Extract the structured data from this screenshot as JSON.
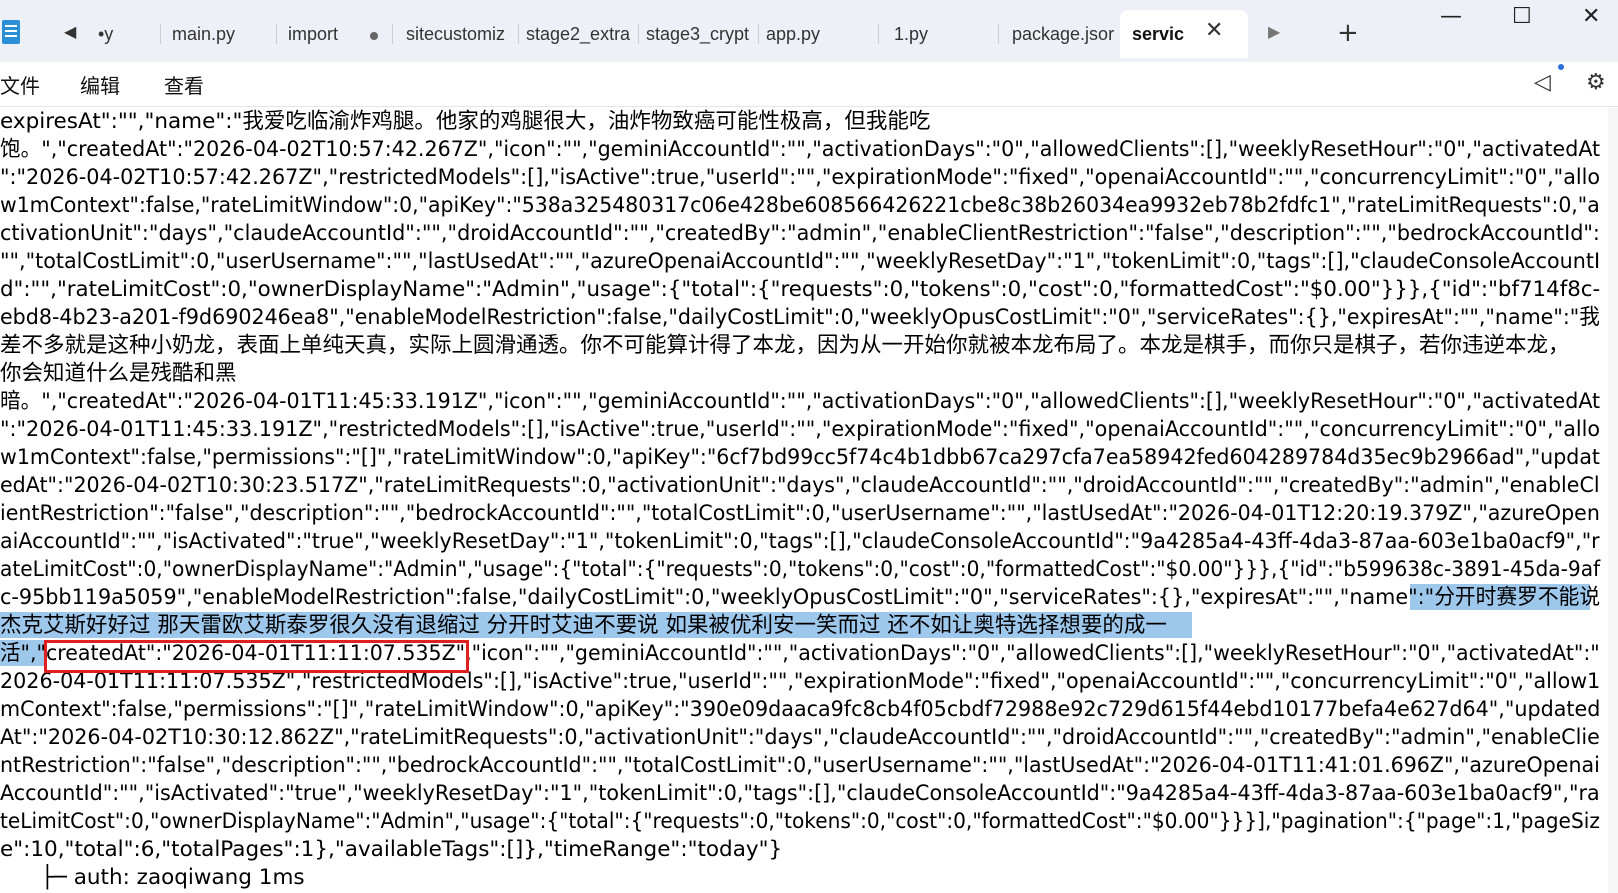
{
  "tabs": [
    {
      "label": "•y",
      "active": false
    },
    {
      "label": "main.py",
      "active": false
    },
    {
      "label": "import",
      "active": false,
      "unsaved": true
    },
    {
      "label": "sitecustomiz",
      "active": false
    },
    {
      "label": "stage2_extra",
      "active": false
    },
    {
      "label": "stage3_crypt",
      "active": false
    },
    {
      "label": "app.py",
      "active": false
    },
    {
      "label": "1.py",
      "active": false
    },
    {
      "label": "package.jsor",
      "active": false
    },
    {
      "label": "servic",
      "active": true
    }
  ],
  "menu": {
    "file": "文件",
    "edit": "编辑",
    "view": "查看"
  },
  "icons": {
    "app": "notepad-icon",
    "back": "◀",
    "forward": "▶",
    "close_tab": "✕",
    "new_tab": "+",
    "minimize": "—",
    "maximize": "☐",
    "close_window": "✕",
    "announce": "◁",
    "settings": "⚙"
  },
  "colors": {
    "tabbar_bg": "#eef0f8",
    "selection": "#9ec7ec",
    "highlight_box": "#e02020"
  },
  "lines": [
    "expiresAt\":\"\",\"name\":\"我爱吃临渝炸鸡腿。他家的鸡腿很大，油炸物致癌可能性极高，但我能吃",
    "饱。\",\"createdAt\":\"2026-04-02T10:57:42.267Z\",\"icon\":\"\",\"geminiAccountId\":\"\",\"activationDays\":\"0\",\"allowedClients\":[],\"weeklyResetHour\":\"0\",\"activatedAt",
    "\":\"2026-04-02T10:57:42.267Z\",\"restrictedModels\":[],\"isActive\":true,\"userId\":\"\",\"expirationMode\":\"fixed\",\"openaiAccountId\":\"\",\"concurrencyLimit\":\"0\",\"allo",
    "w1mContext\":false,\"rateLimitWindow\":0,\"apiKey\":\"538a325480317c06e428be608566426221cbe8c38b26034ea9932eb78b2fdfc1\",\"rateLimitRequests\":0,\"a",
    "ctivationUnit\":\"days\",\"claudeAccountId\":\"\",\"droidAccountId\":\"\",\"createdBy\":\"admin\",\"enableClientRestriction\":\"false\",\"description\":\"\",\"bedrockAccountId\":",
    "\"\",\"totalCostLimit\":0,\"userUsername\":\"\",\"lastUsedAt\":\"\",\"azureOpenaiAccountId\":\"\",\"weeklyResetDay\":\"1\",\"tokenLimit\":0,\"tags\":[],\"claudeConsoleAccountI",
    "d\":\"\",\"rateLimitCost\":0,\"ownerDisplayName\":\"Admin\",\"usage\":{\"total\":{\"requests\":0,\"tokens\":0,\"cost\":0,\"formattedCost\":\"$0.00\"}}},{\"id\":\"bf714f8c-",
    "ebd8-4b23-a201-f9d690246ea8\",\"enableModelRestriction\":false,\"dailyCostLimit\":0,\"weeklyOpusCostLimit\":\"0\",\"serviceRates\":{},\"expiresAt\":\"\",\"name\":\"我",
    "差不多就是这种小奶龙，表面上单纯天真，实际上圆滑通透。你不可能算计得了本龙，因为从一开始你就被本龙布局了。本龙是棋手，而你只是棋子，若你违逆本龙，",
    "你会知道什么是残酷和黑",
    "暗。\",\"createdAt\":\"2026-04-01T11:45:33.191Z\",\"icon\":\"\",\"geminiAccountId\":\"\",\"activationDays\":\"0\",\"allowedClients\":[],\"weeklyResetHour\":\"0\",\"activatedAt",
    "\":\"2026-04-01T11:45:33.191Z\",\"restrictedModels\":[],\"isActive\":true,\"userId\":\"\",\"expirationMode\":\"fixed\",\"openaiAccountId\":\"\",\"concurrencyLimit\":\"0\",\"allo",
    "w1mContext\":false,\"permissions\":\"[]\",\"rateLimitWindow\":0,\"apiKey\":\"6cf7bd99cc5f74c4b1dbb67ca297cfa7ea58942fed604289784d35ec9b2966ad\",\"updat",
    "edAt\":\"2026-04-02T10:30:23.517Z\",\"rateLimitRequests\":0,\"activationUnit\":\"days\",\"claudeAccountId\":\"\",\"droidAccountId\":\"\",\"createdBy\":\"admin\",\"enableCl",
    "ientRestriction\":\"false\",\"description\":\"\",\"bedrockAccountId\":\"\",\"totalCostLimit\":0,\"userUsername\":\"\",\"lastUsedAt\":\"2026-04-01T12:20:19.379Z\",\"azureOpen",
    "aiAccountId\":\"\",\"isActivated\":\"true\",\"weeklyResetDay\":\"1\",\"tokenLimit\":0,\"tags\":[],\"claudeConsoleAccountId\":\"9a4285a4-43ff-4da3-87aa-603e1ba0acf9\",\"r",
    "ateLimitCost\":0,\"ownerDisplayName\":\"Admin\",\"usage\":{\"total\":{\"requests\":0,\"tokens\":0,\"cost\":0,\"formattedCost\":\"$0.00\"}}},{\"id\":\"b599638c-3891-45da-9af",
    "c-95bb119a5059\",\"enableModelRestriction\":false,\"dailyCostLimit\":0,\"weeklyOpusCostLimit\":\"0\",\"serviceRates\":{},\"expiresAt\":\"\",\"name\":\"分开时赛罗不能说",
    "杰克艾斯好好过 那天雷欧艾斯泰罗很久没有退缩过 分开时艾迪不要说 如果被优利安一笑而过 还不如让奥特选择想要的成一",
    "活\",\"createdAt\":\"2026-04-01T11:11:07.535Z\",\"icon\":\"\",\"geminiAccountId\":\"\",\"activationDays\":\"0\",\"allowedClients\":[],\"weeklyResetHour\":\"0\",\"activatedAt\":\"",
    "2026-04-01T11:11:07.535Z\",\"restrictedModels\":[],\"isActive\":true,\"userId\":\"\",\"expirationMode\":\"fixed\",\"openaiAccountId\":\"\",\"concurrencyLimit\":\"0\",\"allow1",
    "mContext\":false,\"permissions\":\"[]\",\"rateLimitWindow\":0,\"apiKey\":\"390e09daaca9fc8cb4f05cbdf72988e92c729d615f44ebd10177befa4e627d64\",\"updated",
    "At\":\"2026-04-02T10:30:12.862Z\",\"rateLimitRequests\":0,\"activationUnit\":\"days\",\"claudeAccountId\":\"\",\"droidAccountId\":\"\",\"createdBy\":\"admin\",\"enableClie",
    "ntRestriction\":\"false\",\"description\":\"\",\"bedrockAccountId\":\"\",\"totalCostLimit\":0,\"userUsername\":\"\",\"lastUsedAt\":\"2026-04-01T11:41:01.696Z\",\"azureOpenai",
    "AccountId\":\"\",\"isActivated\":\"true\",\"weeklyResetDay\":\"1\",\"tokenLimit\":0,\"tags\":[],\"claudeConsoleAccountId\":\"9a4285a4-43ff-4da3-87aa-603e1ba0acf9\",\"ra",
    "teLimitCost\":0,\"ownerDisplayName\":\"Admin\",\"usage\":{\"total\":{\"requests\":0,\"tokens\":0,\"cost\":0,\"formattedCost\":\"$0.00\"}}}],\"pagination\":{\"page\":1,\"pageSiz",
    "e\":10,\"total\":6,\"totalPages\":1},\"availableTags\":[]},\"timeRange\":\"today\"}",
    "      ├─ auth: zaoqiwang 1ms"
  ]
}
